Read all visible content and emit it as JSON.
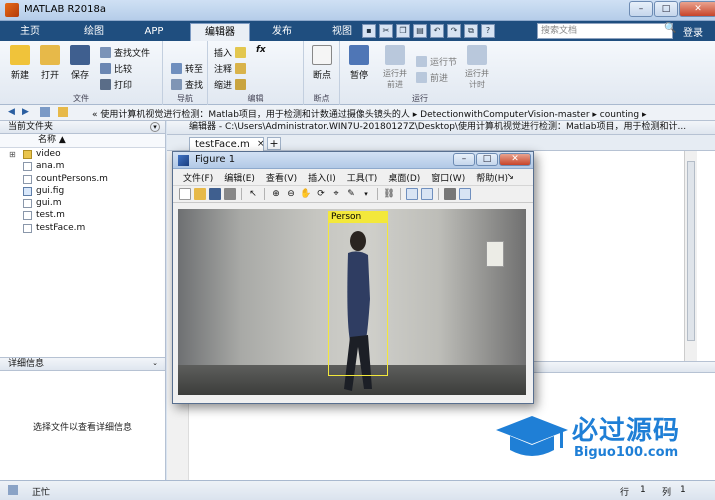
{
  "window": {
    "title": "MATLAB R2018a",
    "minimize": "–",
    "maximize": "□",
    "close": "✕"
  },
  "tabs": [
    {
      "label": "主页"
    },
    {
      "label": "绘图"
    },
    {
      "label": "APP"
    },
    {
      "label": "编辑器"
    },
    {
      "label": "发布"
    },
    {
      "label": "视图"
    }
  ],
  "search": {
    "placeholder": "搜索文档",
    "go": "🔍"
  },
  "login": "登录",
  "ribbon": {
    "file": {
      "label": "文件",
      "new": "新建",
      "open": "打开",
      "save": "保存",
      "find_files": "查找文件",
      "compare": "比较",
      "print": "打印"
    },
    "nav": {
      "label": "导航",
      "goto": "转至",
      "find": "查找"
    },
    "edit": {
      "label": "编辑",
      "insert": "插入",
      "comment": "注释",
      "indent": "缩进",
      "fx": "fx"
    },
    "breakpoints": {
      "label": "断点",
      "breakpoint": "断点"
    },
    "run": {
      "label": "运行",
      "pause": "暂停",
      "run_advance": "运行并\n前进",
      "run_section": "运行节",
      "advance": "前进",
      "run_time": "运行并\n计时"
    }
  },
  "address": {
    "back": "◀",
    "forward": "▶",
    "path": "« 使用计算机视觉进行检测：Matlab项目，用于检测和计数通过摄像头镜头的人 ▸ DetectionwithComputerVision-master ▸ counting ▸"
  },
  "file_panel": {
    "title": "当前文件夹",
    "column": "名称 ▲",
    "files": [
      {
        "name": "video",
        "type": "folder"
      },
      {
        "name": "ana.m",
        "type": "m"
      },
      {
        "name": "countPersons.m",
        "type": "m"
      },
      {
        "name": "gui.fig",
        "type": "fig"
      },
      {
        "name": "gui.m",
        "type": "m"
      },
      {
        "name": "test.m",
        "type": "m"
      },
      {
        "name": "testFace.m",
        "type": "m"
      }
    ]
  },
  "detail_panel": {
    "title": "详细信息",
    "hint": "选择文件以查看详细信息"
  },
  "editor": {
    "header": "编辑器 - C:\\Users\\Administrator.WIN7U-20180127Z\\Desktop\\使用计算机视觉进行检测：Matlab项目，用于检测和计...",
    "tab": "testFace.m",
    "tab_close": "×",
    "add_tab": "+"
  },
  "figure": {
    "title": "Figure 1",
    "menu": [
      "文件(F)",
      "编辑(E)",
      "查看(V)",
      "插入(I)",
      "工具(T)",
      "桌面(D)",
      "窗口(W)",
      "帮助(H)"
    ],
    "more": "↘",
    "label": "Person"
  },
  "status": {
    "ready": "正忙",
    "row_label": "行",
    "row": "1",
    "col_label": "列",
    "col": "1"
  },
  "watermark": {
    "title": "必过源码",
    "site": "Biguo100.com"
  }
}
